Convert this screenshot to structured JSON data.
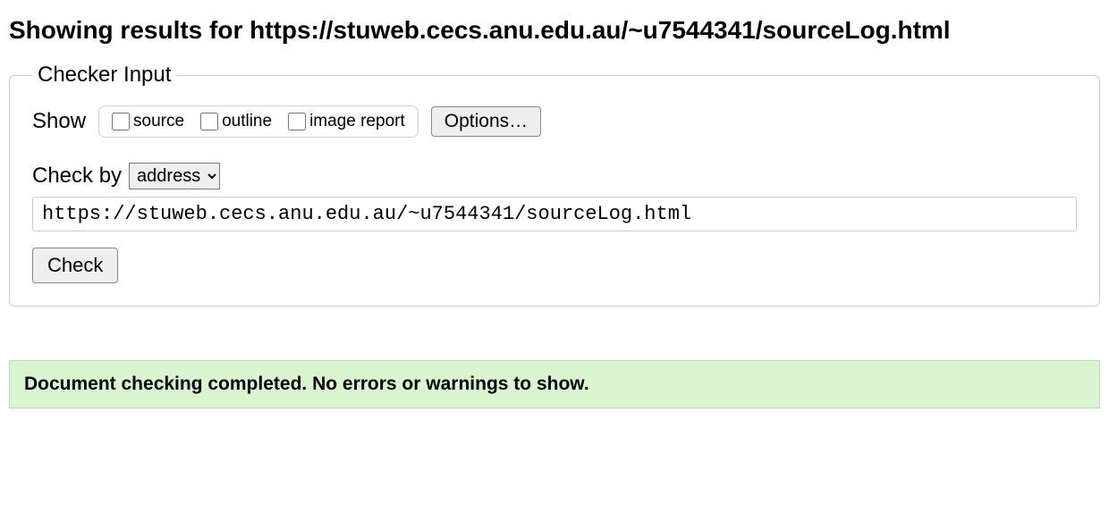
{
  "pageTitle": "Showing results for https://stuweb.cecs.anu.edu.au/~u7544341/sourceLog.html",
  "fieldset": {
    "legend": "Checker Input",
    "showLabel": "Show",
    "checkboxes": {
      "source": "source",
      "outline": "outline",
      "imageReport": "image report"
    },
    "optionsButton": "Options…",
    "checkByLabel": "Check by",
    "checkBySelected": "address",
    "urlValue": "https://stuweb.cecs.anu.edu.au/~u7544341/sourceLog.html",
    "checkButton": "Check"
  },
  "resultMessage": "Document checking completed. No errors or warnings to show."
}
